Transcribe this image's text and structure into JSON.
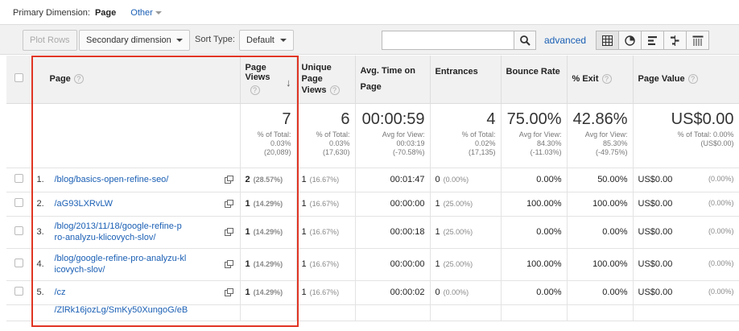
{
  "dimension_bar": {
    "label": "Primary Dimension:",
    "current": "Page",
    "other": "Other"
  },
  "toolbar": {
    "plot_rows": "Plot Rows",
    "secondary_dimension": "Secondary dimension",
    "sort_type_label": "Sort Type:",
    "sort_type_value": "Default",
    "search_value": "",
    "advanced": "advanced"
  },
  "columns": {
    "page": "Page",
    "pageviews": "Page Views",
    "unique": "Unique Page Views",
    "avg_time": "Avg. Time on Page",
    "entrances": "Entrances",
    "bounce": "Bounce Rate",
    "exit": "% Exit",
    "value": "Page Value"
  },
  "summary": {
    "pageviews": {
      "big": "7",
      "l1": "% of Total:",
      "l2": "0.03%",
      "l3": "(20,089)"
    },
    "unique": {
      "big": "6",
      "l1": "% of Total:",
      "l2": "0.03%",
      "l3": "(17,630)"
    },
    "avg_time": {
      "big": "00:00:59",
      "l1": "Avg for View:",
      "l2": "00:03:19",
      "l3": "(-70.58%)"
    },
    "entrances": {
      "big": "4",
      "l1": "% of Total:",
      "l2": "0.02%",
      "l3": "(17,135)"
    },
    "bounce": {
      "big": "75.00%",
      "l1": "Avg for View:",
      "l2": "84.30%",
      "l3": "(-11.03%)"
    },
    "exit": {
      "big": "42.86%",
      "l1": "Avg for View:",
      "l2": "85.30%",
      "l3": "(-49.75%)"
    },
    "value": {
      "big": "US$0.00",
      "l1": "% of Total: 0.00%",
      "l2": "(US$0.00)",
      "l3": ""
    }
  },
  "rows": [
    {
      "idx": "1.",
      "page": "/blog/basics-open-refine-seo/",
      "pv": "2",
      "pv_pct": "(28.57%)",
      "upv": "1",
      "upv_pct": "(16.67%)",
      "time": "00:01:47",
      "ent": "0",
      "ent_pct": "(0.00%)",
      "bounce": "0.00%",
      "exit": "50.00%",
      "value": "US$0.00",
      "value_pct": "(0.00%)"
    },
    {
      "idx": "2.",
      "page": "/aG93LXRvLW",
      "pv": "1",
      "pv_pct": "(14.29%)",
      "upv": "1",
      "upv_pct": "(16.67%)",
      "time": "00:00:00",
      "ent": "1",
      "ent_pct": "(25.00%)",
      "bounce": "100.00%",
      "exit": "100.00%",
      "value": "US$0.00",
      "value_pct": "(0.00%)"
    },
    {
      "idx": "3.",
      "page_l1": "/blog/2013/11/18/google-refine-p",
      "page_l2": "ro-analyzu-klicovych-slov/",
      "pv": "1",
      "pv_pct": "(14.29%)",
      "upv": "1",
      "upv_pct": "(16.67%)",
      "time": "00:00:18",
      "ent": "1",
      "ent_pct": "(25.00%)",
      "bounce": "0.00%",
      "exit": "0.00%",
      "value": "US$0.00",
      "value_pct": "(0.00%)"
    },
    {
      "idx": "4.",
      "page_l1": "/blog/google-refine-pro-analyzu-kl",
      "page_l2": "icovych-slov/",
      "pv": "1",
      "pv_pct": "(14.29%)",
      "upv": "1",
      "upv_pct": "(16.67%)",
      "time": "00:00:00",
      "ent": "1",
      "ent_pct": "(25.00%)",
      "bounce": "100.00%",
      "exit": "100.00%",
      "value": "US$0.00",
      "value_pct": "(0.00%)"
    },
    {
      "idx": "5.",
      "page": "/cz",
      "pv": "1",
      "pv_pct": "(14.29%)",
      "upv": "1",
      "upv_pct": "(16.67%)",
      "time": "00:00:02",
      "ent": "0",
      "ent_pct": "(0.00%)",
      "bounce": "0.00%",
      "exit": "0.00%",
      "value": "US$0.00",
      "value_pct": "(0.00%)"
    }
  ],
  "cut_row": {
    "page": "/ZlRk16jozLg/SmKy50XungoG/eB"
  },
  "colors": {
    "highlight": "#e03524",
    "link": "#1a5fb4"
  }
}
